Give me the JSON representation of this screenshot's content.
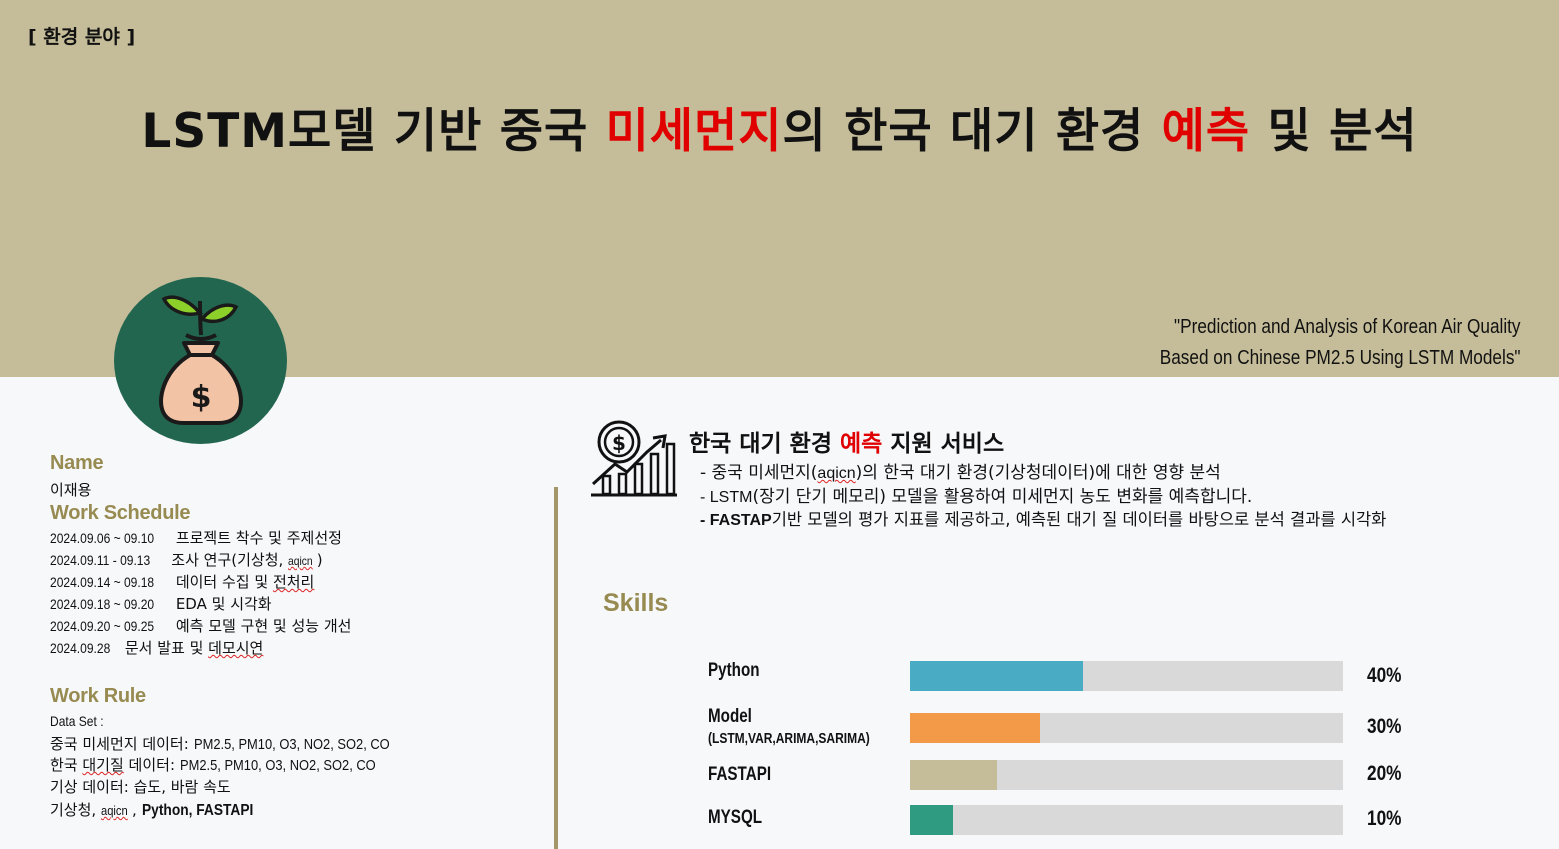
{
  "header": {
    "category": "[ 환경 분야 ]",
    "title_part1": "LSTM모델 기반 중국 ",
    "title_red1": "미세먼지",
    "title_part2": "의 한국 대기 환경 ",
    "title_red2": "예측",
    "title_part3": " 및 분석",
    "subtitle_line1": "\"Prediction and Analysis of Korean Air Quality",
    "subtitle_line2": "Based on Chinese PM2.5 Using LSTM Models\""
  },
  "profile": {
    "logo_icon": "money-bag-plant-icon",
    "name_heading": "Name",
    "name_value": "이재용"
  },
  "schedule": {
    "heading": "Work Schedule",
    "items": [
      {
        "date": "2024.09.06 ~ 09.10",
        "text": " 프로젝트 착수 및 주제선정"
      },
      {
        "date": "2024.09.11 - 09.13",
        "text": " 조사 연구(기상청, ",
        "tail": "aqicn",
        "end": ")"
      },
      {
        "date": "2024.09.14 ~ 09.18",
        "text": " 데이터 수집 및 ",
        "tail": "전처리",
        "end": ""
      },
      {
        "date": "2024.09.18 ~ 09.20",
        "text": " EDA 및 시각화",
        "tail": "",
        "end": ""
      },
      {
        "date": "2024.09.20 ~ 09.25",
        "text": " 예측 모델 구현 및 성능 개선",
        "tail": "",
        "end": ""
      },
      {
        "date": "2024.09.28",
        "text": " 문서 발표 및 ",
        "tail": "데모시연",
        "end": ""
      }
    ]
  },
  "rule": {
    "heading": "Work Rule",
    "dataset_label": "Data Set :",
    "line1_kr": "중국 미세먼지 데이터: ",
    "line1_val": "PM2.5, PM10, O3, NO2, SO2, CO",
    "line2_kr_a": "한국 ",
    "line2_kr_b": "대기질",
    "line2_kr_c": " 데이터: ",
    "line2_val": "PM2.5, PM10, O3, NO2, SO2, CO",
    "line3": "기상 데이터: 습도, 바람 속도",
    "line4_a": "기상청, ",
    "line4_b": "aqicn",
    "line4_c": ", ",
    "line4_bold": "Python, FASTAPI"
  },
  "service": {
    "icon": "dollar-growth-chart-icon",
    "title_a": "한국 대기 환경 ",
    "title_red": "예측",
    "title_b": " 지원 서비스",
    "line1_a": "- 중국 미세먼지(",
    "line1_b": "aqicn",
    "line1_c": ")의 한국 대기 환경(기상청데이터)에 대한 영향 분석",
    "line2_a": "- LSTM",
    "line2_b": "(장기 단기 메모리) 모델을 활용하여 미세먼지 농도 변화를 예측합니다.",
    "line3_a": "- FASTAP",
    "line3_b": "기반 모델의 평가 지표를 제공하고, 예측된 대기 질 데이터를 바탕으로 분석 결과를 시각화"
  },
  "skills": {
    "heading": "Skills",
    "items": [
      {
        "label": "Python",
        "sub": "",
        "percent": 40,
        "pct_label": "40%",
        "color": "#4aabc5"
      },
      {
        "label": "Model",
        "sub": "(LSTM,VAR,ARIMA,SARIMA)",
        "percent": 30,
        "pct_label": "30%",
        "color": "#f39a48"
      },
      {
        "label": "FASTAPI",
        "sub": "",
        "percent": 20,
        "pct_label": "20%",
        "color": "#c5bd99"
      },
      {
        "label": "MYSQL",
        "sub": "",
        "percent": 10,
        "pct_label": "10%",
        "color": "#2f9c82"
      }
    ]
  },
  "colors": {
    "banner": "#c5bd99",
    "accent_red": "#e00000",
    "heading_gold": "#978b52",
    "logo_green": "#226650"
  }
}
